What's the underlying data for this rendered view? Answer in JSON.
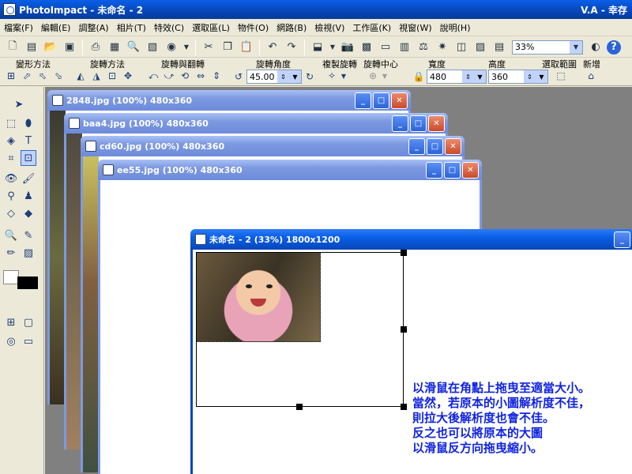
{
  "app": {
    "title": "PhotoImpact - 未命名 - 2",
    "title_right": "V.A - 幸存"
  },
  "menu": [
    "檔案(F)",
    "編輯(E)",
    "調整(A)",
    "相片(T)",
    "特效(C)",
    "選取區(L)",
    "物件(O)",
    "網路(B)",
    "檢視(V)",
    "工作區(K)",
    "視窗(W)",
    "說明(H)"
  ],
  "toolbar": {
    "zoom_value": "33%"
  },
  "attr_bar": {
    "deform_label": "變形方法",
    "rotate_method_label": "旋轉方法",
    "rotate_flip_label": "旋轉與翻轉",
    "rotate_angle_label": "旋轉角度",
    "angle_value": "45.00",
    "copy_rotate_label": "複製旋轉",
    "rotate_center_label": "旋轉中心",
    "width_label": "寬度",
    "width_value": "480",
    "height_label": "高度",
    "height_value": "360",
    "select_range_label": "選取範圍",
    "new_label": "新增"
  },
  "windows": [
    {
      "title": "2848.jpg (100%) 480x360"
    },
    {
      "title": "baa4.jpg (100%) 480x360"
    },
    {
      "title": "cd60.jpg (100%) 480x360"
    },
    {
      "title": "ee55.jpg (100%) 480x360"
    },
    {
      "title": "未命名 - 2 (33%) 1800x1200"
    }
  ],
  "instruction": {
    "line1": "以滑鼠在角點上拖曳至適當大小。",
    "line2": "當然，若原本的小圖解析度不佳，",
    "line3": "則拉大後解析度也會不佳。",
    "line4": "反之也可以將原本的大圖",
    "line5": "以滑鼠反方向拖曳縮小。"
  },
  "colors": {
    "titlebar_active": "#0746b8",
    "titlebar_inactive": "#7d99e0",
    "instruction_text": "#1024e0"
  }
}
